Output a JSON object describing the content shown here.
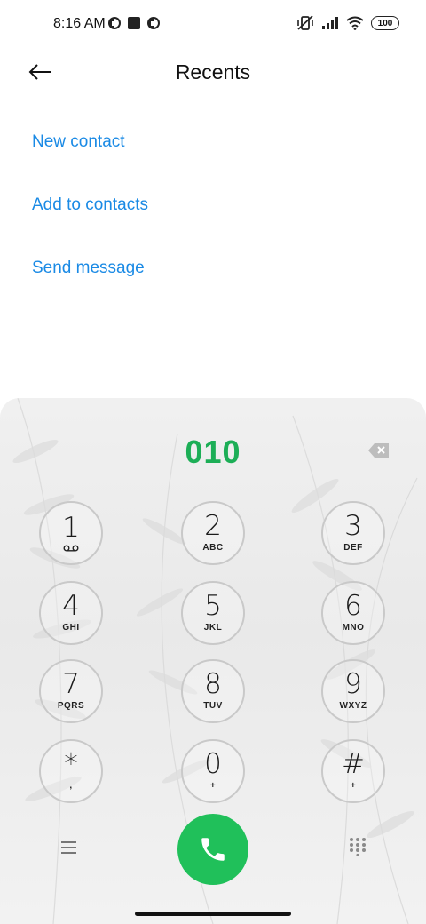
{
  "status_bar": {
    "time": "8:16 AM",
    "battery": "100"
  },
  "header": {
    "title": "Recents"
  },
  "actions": {
    "new_contact": "New contact",
    "add_to_contacts": "Add to contacts",
    "send_message": "Send message"
  },
  "dialer": {
    "number": "010",
    "keys": [
      {
        "digit": "1",
        "letters": ""
      },
      {
        "digit": "2",
        "letters": "ABC"
      },
      {
        "digit": "3",
        "letters": "DEF"
      },
      {
        "digit": "4",
        "letters": "GHI"
      },
      {
        "digit": "5",
        "letters": "JKL"
      },
      {
        "digit": "6",
        "letters": "MNO"
      },
      {
        "digit": "7",
        "letters": "PQRS"
      },
      {
        "digit": "8",
        "letters": "TUV"
      },
      {
        "digit": "9",
        "letters": "WXYZ"
      },
      {
        "digit": "*",
        "letters": ","
      },
      {
        "digit": "0",
        "letters": "+"
      },
      {
        "digit": "#",
        "letters": "+"
      }
    ]
  },
  "colors": {
    "link": "#1a8ae5",
    "number": "#1cae56",
    "call": "#20c05a"
  }
}
